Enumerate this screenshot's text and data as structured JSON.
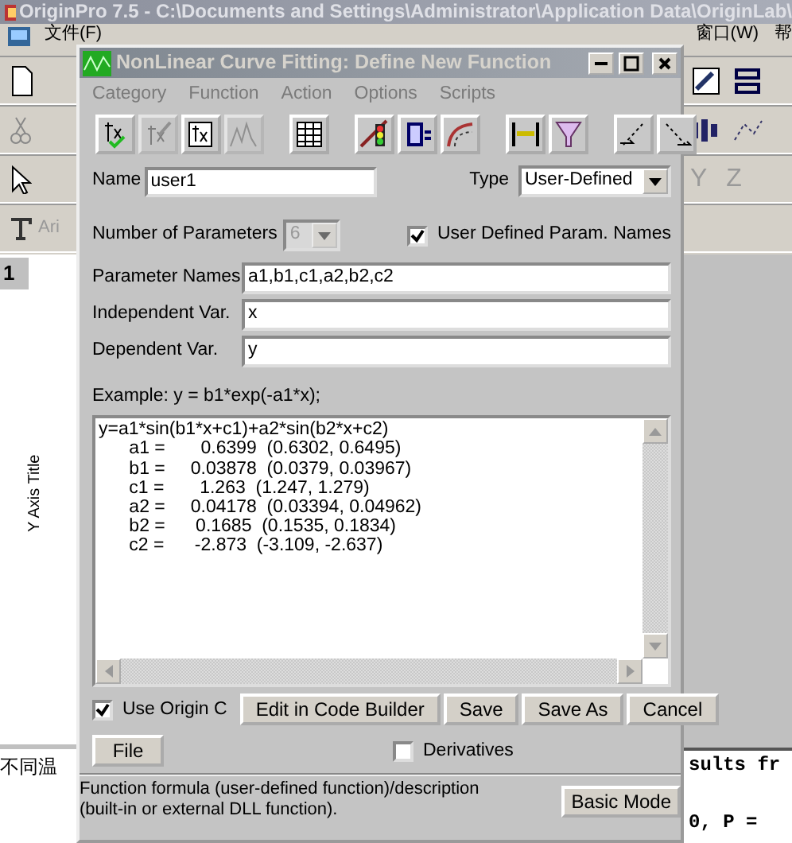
{
  "app": {
    "title": "OriginPro 7.5 - C:\\Documents and Settings\\Administrator\\Application Data\\OriginLab\\",
    "menu": [
      "文件(F)",
      "窗口(W)",
      "帮"
    ],
    "font_box": "Ari",
    "row_header": "1",
    "axis_title": "Y Axis Title",
    "panel_title": "不同温",
    "axis_buttons": [
      "Y",
      "Z"
    ],
    "results_lines": [
      "sults fr",
      "0, P = "
    ]
  },
  "dialog": {
    "title": "NonLinear Curve Fitting:  Define New Function",
    "menu": [
      "Category",
      "Function",
      "Action",
      "Options",
      "Scripts"
    ],
    "toolbar": [
      [
        {
          "kind": "fx-check",
          "disabled": false
        },
        {
          "kind": "fx-edit",
          "disabled": true
        },
        {
          "kind": "fx-file",
          "disabled": false
        },
        {
          "kind": "peaks",
          "disabled": true
        }
      ],
      [
        {
          "kind": "table",
          "disabled": false
        }
      ],
      [
        {
          "kind": "signal",
          "disabled": false
        },
        {
          "kind": "param",
          "disabled": false
        },
        {
          "kind": "curve",
          "disabled": false
        }
      ],
      [
        {
          "kind": "range",
          "disabled": false
        },
        {
          "kind": "funnel",
          "disabled": false
        }
      ],
      [
        {
          "kind": "dots-forward",
          "disabled": false
        },
        {
          "kind": "dots-down",
          "disabled": false
        }
      ]
    ],
    "name": {
      "label": "Name",
      "value": "user1"
    },
    "type": {
      "label": "Type",
      "value": "User-Defined"
    },
    "num_params": {
      "label": "Number of Parameters",
      "value": "6",
      "disabled": true
    },
    "user_names": {
      "label": "User Defined Param. Names",
      "checked": true
    },
    "fields": [
      {
        "label": "Parameter Names",
        "value": "a1,b1,c1,a2,b2,c2"
      },
      {
        "label": "Independent Var.",
        "value": "x"
      },
      {
        "label": "Dependent Var.",
        "value": "y"
      }
    ],
    "example": "Example: y = b1*exp(-a1*x);",
    "code": [
      "y=a1*sin(b1*x+c1)+a2*sin(b2*x+c2)",
      "      a1 =       0.6399  (0.6302, 0.6495)",
      "      b1 =     0.03878  (0.0379, 0.03967)",
      "      c1 =       1.263  (1.247, 1.279)",
      "      a2 =     0.04178  (0.03394, 0.04962)",
      "      b2 =      0.1685  (0.1535, 0.1834)",
      "      c2 =      -2.873  (-3.109, -2.637)"
    ],
    "use_origin_c": {
      "label": "Use Origin C",
      "checked": true
    },
    "buttons": [
      "Edit in Code Builder",
      "Save",
      "Save As",
      "Cancel"
    ],
    "file_button": "File",
    "derivatives": {
      "label": "Derivatives",
      "checked": false
    },
    "hint": "Function formula (user-defined function)/description (built-in or external DLL function).",
    "mode_button": "Basic Mode"
  }
}
